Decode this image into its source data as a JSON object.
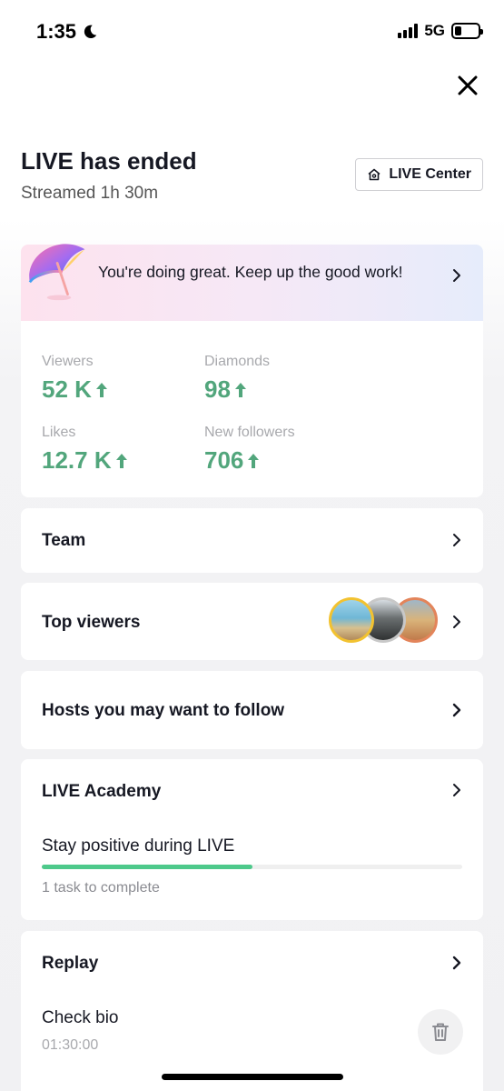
{
  "status_bar": {
    "time": "1:35",
    "network": "5G",
    "battery_level": 0.3
  },
  "header": {
    "title": "LIVE has ended",
    "subtitle": "Streamed 1h 30m",
    "live_center_label": "LIVE Center"
  },
  "banner": {
    "text": "You're doing great. Keep up the good work!"
  },
  "stats": {
    "viewers": {
      "label": "Viewers",
      "value": "52 K"
    },
    "diamonds": {
      "label": "Diamonds",
      "value": "98"
    },
    "likes": {
      "label": "Likes",
      "value": "12.7 K"
    },
    "new_followers": {
      "label": "New followers",
      "value": "706"
    }
  },
  "team": {
    "label": "Team"
  },
  "top_viewers": {
    "label": "Top viewers"
  },
  "hosts": {
    "label": "Hosts you may want to follow"
  },
  "academy": {
    "label": "LIVE Academy",
    "task_title": "Stay positive during LIVE",
    "task_status": "1 task to complete",
    "progress": 0.5
  },
  "replay": {
    "label": "Replay",
    "item_title": "Check bio",
    "item_duration": "01:30:00"
  },
  "colors": {
    "accent_green": "#52a67c",
    "progress_green": "#4ec98b",
    "avatar_ring_1": "#f2c230",
    "avatar_ring_2": "#c8c8c8",
    "avatar_ring_3": "#e3845a"
  }
}
